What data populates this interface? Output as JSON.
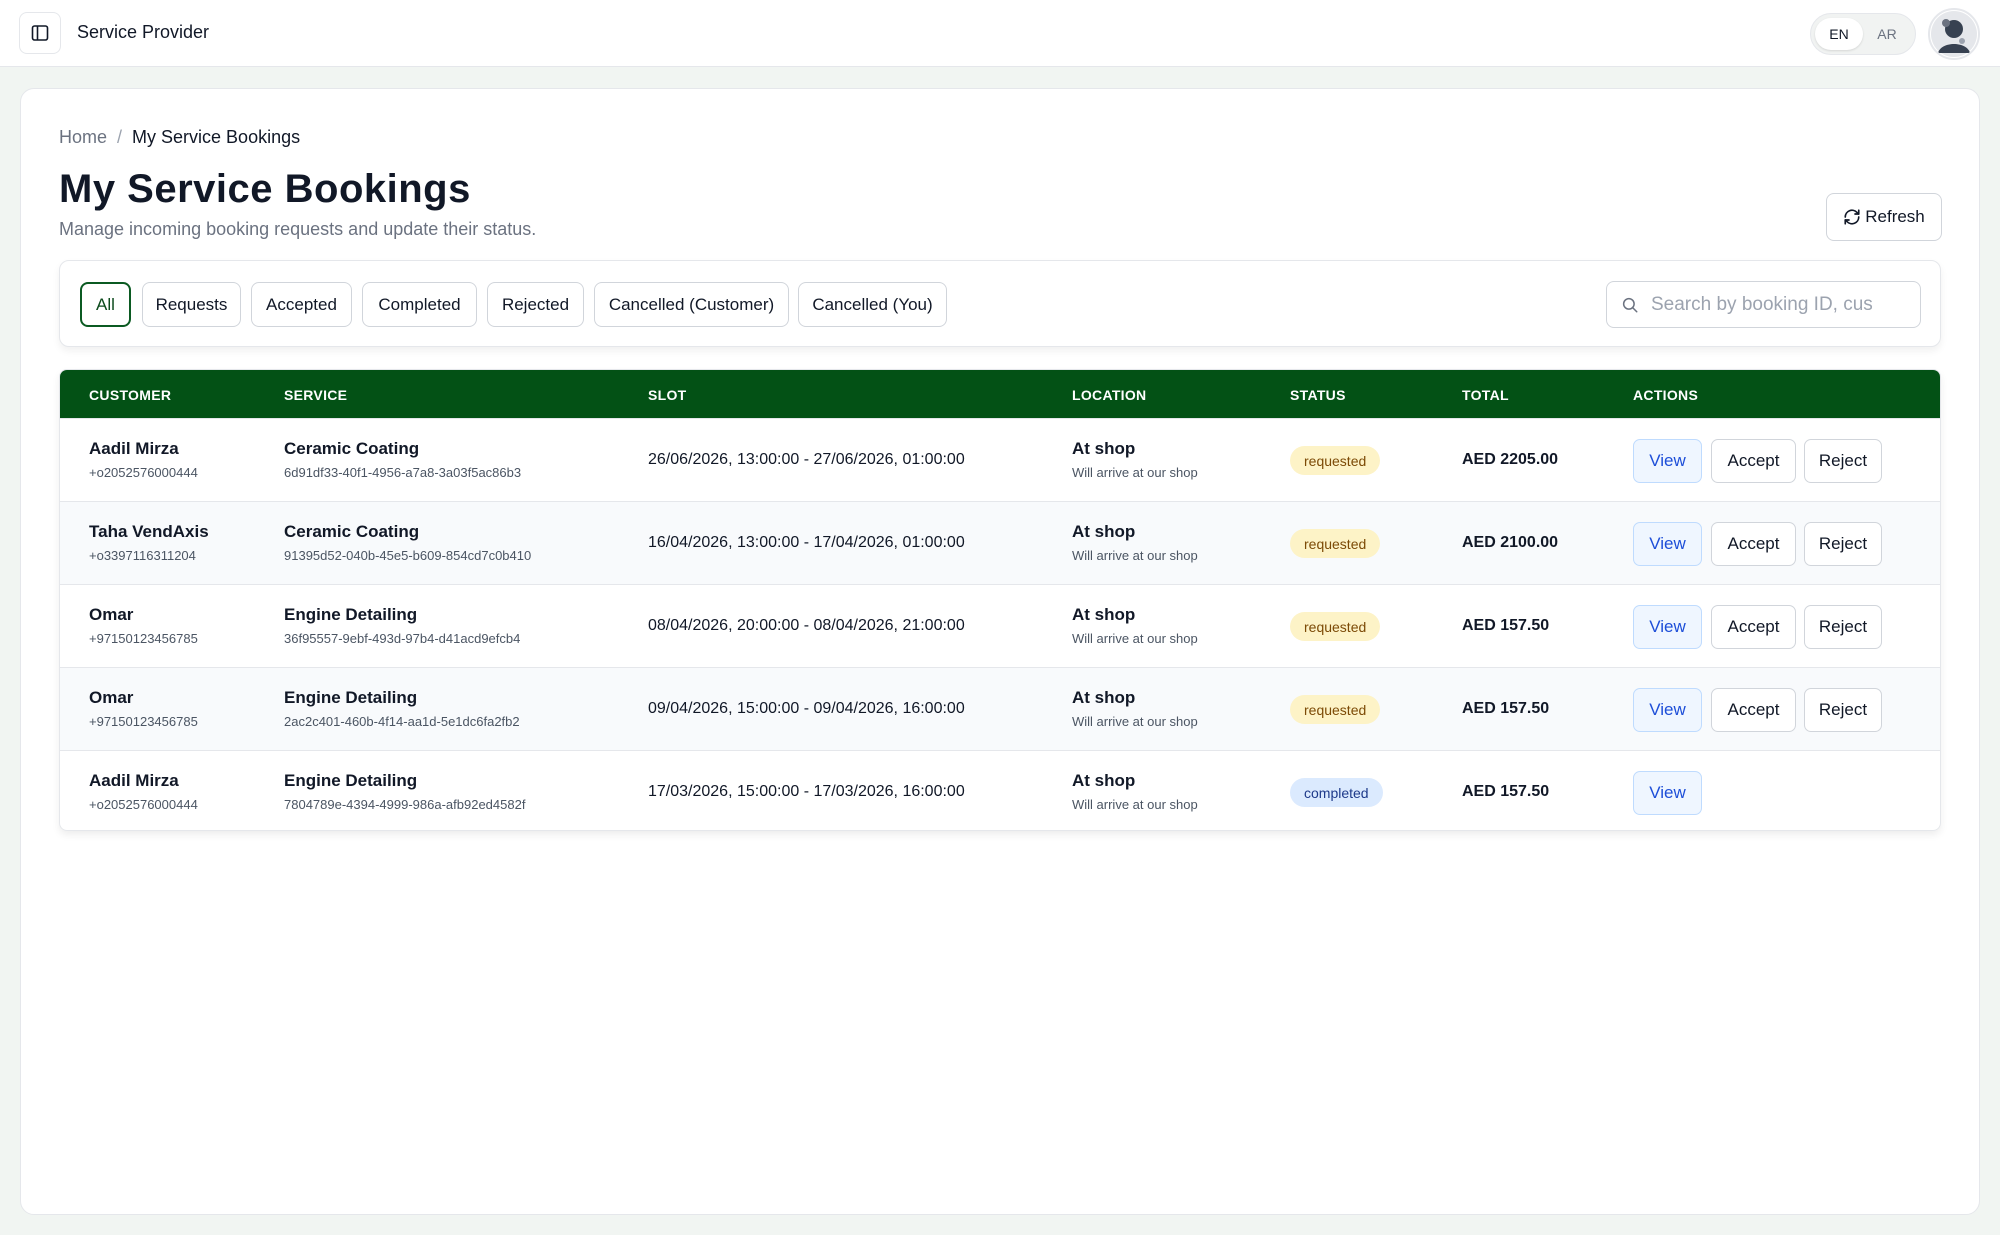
{
  "header": {
    "app_title": "Service Provider",
    "lang": {
      "en": "EN",
      "ar": "AR",
      "selected": "EN"
    }
  },
  "breadcrumb": {
    "home": "Home",
    "separator": "/",
    "current": "My Service Bookings"
  },
  "page": {
    "title": "My Service Bookings",
    "subtitle": "Manage incoming booking requests and update their status.",
    "refresh_label": "Refresh"
  },
  "filters": {
    "chips": [
      "All",
      "Requests",
      "Accepted",
      "Completed",
      "Rejected",
      "Cancelled (Customer)",
      "Cancelled (You)"
    ],
    "active": "All",
    "search_placeholder": "Search by booking ID, cus"
  },
  "table": {
    "columns": [
      "CUSTOMER",
      "SERVICE",
      "SLOT",
      "LOCATION",
      "STATUS",
      "TOTAL",
      "ACTIONS"
    ],
    "actions": {
      "view": "View",
      "accept": "Accept",
      "reject": "Reject"
    },
    "rows": [
      {
        "customer": "Aadil Mirza",
        "phone": "+o2052576000444",
        "service": "Ceramic Coating",
        "booking_id": "6d91df33-40f1-4956-a7a8-3a03f5ac86b3",
        "slot": "26/06/2026, 13:00:00 - 27/06/2026, 01:00:00",
        "location": "At shop",
        "location_note": "Will arrive at our shop",
        "status": "requested",
        "total": "AED 2205.00"
      },
      {
        "customer": "Taha VendAxis",
        "phone": "+o3397116311204",
        "service": "Ceramic Coating",
        "booking_id": "91395d52-040b-45e5-b609-854cd7c0b410",
        "slot": "16/04/2026, 13:00:00 - 17/04/2026, 01:00:00",
        "location": "At shop",
        "location_note": "Will arrive at our shop",
        "status": "requested",
        "total": "AED 2100.00"
      },
      {
        "customer": "Omar",
        "phone": "+97150123456785",
        "service": "Engine Detailing",
        "booking_id": "36f95557-9ebf-493d-97b4-d41acd9efcb4",
        "slot": "08/04/2026, 20:00:00 - 08/04/2026, 21:00:00",
        "location": "At shop",
        "location_note": "Will arrive at our shop",
        "status": "requested",
        "total": "AED 157.50"
      },
      {
        "customer": "Omar",
        "phone": "+97150123456785",
        "service": "Engine Detailing",
        "booking_id": "2ac2c401-460b-4f14-aa1d-5e1dc6fa2fb2",
        "slot": "09/04/2026, 15:00:00 - 09/04/2026, 16:00:00",
        "location": "At shop",
        "location_note": "Will arrive at our shop",
        "status": "requested",
        "total": "AED 157.50"
      },
      {
        "customer": "Aadil Mirza",
        "phone": "+o2052576000444",
        "service": "Engine Detailing",
        "booking_id": "7804789e-4394-4999-986a-afb92ed4582f",
        "slot": "17/03/2026, 15:00:00 - 17/03/2026, 16:00:00",
        "location": "At shop",
        "location_note": "Will arrive at our shop",
        "status": "completed",
        "total": "AED 157.50"
      }
    ]
  },
  "icons": {
    "sidebar_toggle": "sidebar-toggle-icon",
    "refresh": "refresh-icon",
    "search": "search-icon",
    "avatar": "user-avatar"
  },
  "colors": {
    "header_green": "#035115",
    "active_chip": "#0b5a22",
    "requested_bg": "#fdf3c7",
    "completed_bg": "#dbeafe",
    "view_btn": "#eff6ff"
  }
}
